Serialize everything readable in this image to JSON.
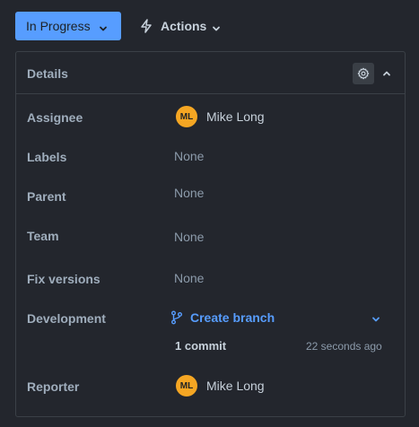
{
  "toolbar": {
    "status_label": "In Progress",
    "actions_label": "Actions"
  },
  "details": {
    "title": "Details",
    "fields": {
      "assignee": {
        "label": "Assignee",
        "avatar_initials": "ML",
        "name": "Mike Long"
      },
      "labels": {
        "label": "Labels",
        "value": "None"
      },
      "parent": {
        "label": "Parent",
        "value": "None"
      },
      "team": {
        "label": "Team",
        "value": "None"
      },
      "fix_versions": {
        "label": "Fix versions",
        "value": "None"
      },
      "development": {
        "label": "Development",
        "link_text": "Create branch",
        "commit_count": "1 commit",
        "commit_time": "22 seconds ago"
      },
      "reporter": {
        "label": "Reporter",
        "avatar_initials": "ML",
        "name": "Mike Long"
      }
    }
  },
  "colors": {
    "background": "#23262d",
    "status_button": "#579dff",
    "link": "#579dff",
    "avatar": "#f5a623"
  },
  "icons": [
    "chevron-down-icon",
    "lightning-bolt-icon",
    "gear-icon",
    "chevron-up-icon",
    "branch-icon"
  ]
}
